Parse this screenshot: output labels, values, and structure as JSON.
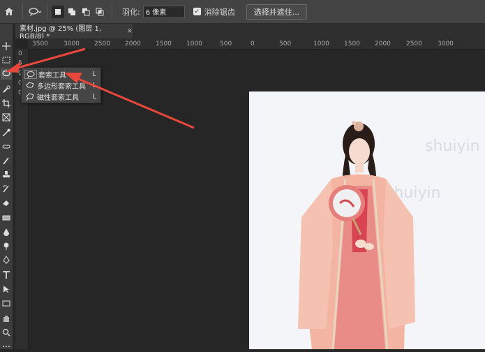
{
  "options_bar": {
    "feather_label": "羽化:",
    "feather_value": "6 像素",
    "antialias_label": "消除锯齿",
    "antialias_checked": "✓",
    "select_mask_label": "选择并遮住..."
  },
  "document_tab": {
    "title": "素材.jpg @ 25% (图层 1, RGB/8) *",
    "close": "×"
  },
  "ruler": {
    "horizontal": [
      "3500",
      "3000",
      "2500",
      "2000",
      "1500",
      "1000",
      "500",
      "0",
      "500",
      "1000",
      "1500",
      "2000",
      "2500",
      "3000"
    ],
    "vertical": [
      "0",
      "5",
      "0",
      "0",
      "0"
    ]
  },
  "flyout": {
    "items": [
      {
        "label": "套索工具",
        "shortcut": "L",
        "icon": "lasso-icon"
      },
      {
        "label": "多边形套索工具",
        "shortcut": "L",
        "icon": "polygonal-lasso-icon"
      },
      {
        "label": "磁性套索工具",
        "shortcut": "L",
        "icon": "magnetic-lasso-icon"
      }
    ]
  },
  "canvas": {
    "watermark_1": "shuiyin",
    "watermark_2": "shuiyin"
  },
  "colors": {
    "arrow": "#e8473b",
    "canvas_bg": "#f4f5f8",
    "dress": "#f3b4a2"
  }
}
